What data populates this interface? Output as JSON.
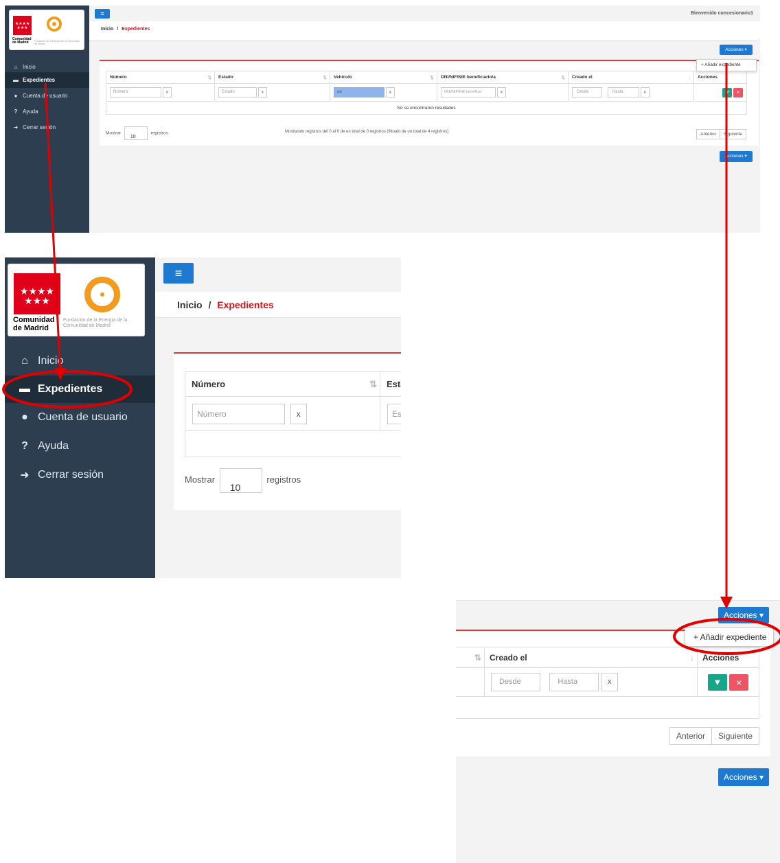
{
  "logo": {
    "region": "Comunidad de Madrid",
    "foundation": "Fundación de la Energía de la Comunidad de Madrid"
  },
  "header": {
    "welcome": "Bienvenido concesionario1"
  },
  "breadcrumb": {
    "home": "Inicio",
    "separator": "/",
    "current": "Expedientes"
  },
  "sidebar": {
    "items": [
      {
        "label": "Inicio",
        "icon": "home-icon"
      },
      {
        "label": "Expedientes",
        "icon": "archive-icon"
      },
      {
        "label": "Cuenta de usuario",
        "icon": "user-icon"
      },
      {
        "label": "Ayuda",
        "icon": "question-icon"
      },
      {
        "label": "Cerrar sesión",
        "icon": "sign-out-icon"
      }
    ]
  },
  "actions": {
    "button": "Acciones ▾",
    "menu_item": "+ Añadir expediente"
  },
  "table": {
    "columns": [
      "Número",
      "Estado",
      "Vehículo",
      "DNI/NIF/NIE beneficiario/a",
      "Creado el",
      "Acciones"
    ],
    "filters": {
      "numero_placeholder": "Número",
      "estado_placeholder": "Estado",
      "vehiculo_value": "aa",
      "dni_placeholder": "DNI/NIF/NIE beneficia",
      "desde_placeholder": "Desde",
      "hasta_placeholder": "Hasta",
      "clear": "x"
    },
    "empty": "No se encontraron resultados"
  },
  "footer": {
    "show_label": "Mostrar",
    "page_size": "10",
    "records_label": "registros",
    "info": "Mostrando registros del 0 al 0 de un total de 0 registros (filtrado de un total de 4 registros)",
    "prev": "Anterior",
    "next": "Siguiente"
  },
  "colors": {
    "sidebar": "#2c3e50",
    "accent_blue": "#1e7ad1",
    "accent_red": "#d4151c",
    "annotation": "#e10000"
  }
}
